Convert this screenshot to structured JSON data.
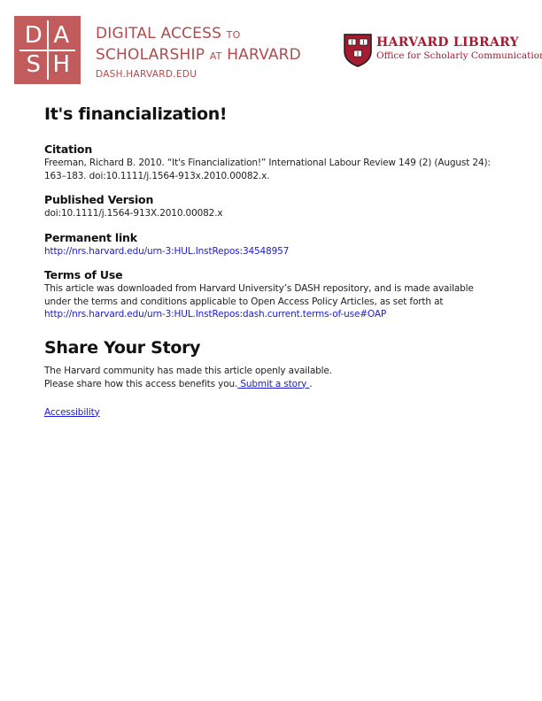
{
  "header": {
    "dash_logo_letters": [
      "D",
      "A",
      "S",
      "H"
    ],
    "dash_line1_main": "DIGITAL ACCESS",
    "dash_line1_small": "TO",
    "dash_line2_main": "SCHOLARSHIP",
    "dash_line2_small": "AT",
    "dash_line2_end": "HARVARD",
    "dash_url": "DASH.HARVARD.EDU",
    "library_title": "HARVARD LIBRARY",
    "library_subtitle": "Office for Scholarly Communication",
    "colors": {
      "dash": "#c25b5c",
      "harvard": "#a51c30"
    }
  },
  "title": "It's financialization!",
  "citation": {
    "label": "Citation",
    "text": "Freeman, Richard B. 2010. “It's Financialization!” International Labour Review 149 (2) (August 24): 163–183. doi:10.1111/j.1564-913x.2010.00082.x."
  },
  "published_version": {
    "label": "Published Version",
    "text": "doi:10.1111/j.1564-913X.2010.00082.x"
  },
  "permanent_link": {
    "label": "Permanent link",
    "url": "http://nrs.harvard.edu/urn-3:HUL.InstRepos:34548957"
  },
  "terms": {
    "label": "Terms of Use",
    "text": "This article was downloaded from Harvard University’s DASH repository, and is made available under the terms and conditions applicable to Open Access Policy Articles, as set forth at ",
    "link": "http://nrs.harvard.edu/urn-3:HUL.InstRepos:dash.current.terms-of-use#OAP"
  },
  "share": {
    "title": "Share Your Story",
    "line1": "The Harvard community has made this article openly available.",
    "line2": "Please share how this access benefits you.",
    "link": " Submit a story ",
    "after": "."
  },
  "accessibility": "Accessibility"
}
